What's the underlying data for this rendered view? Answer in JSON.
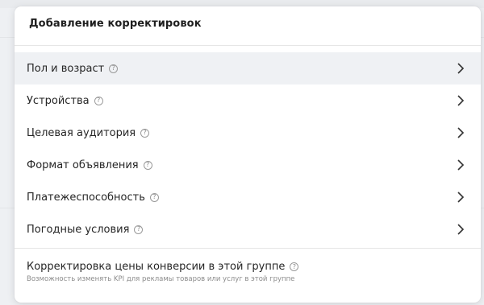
{
  "popup": {
    "title": "Добавление корректировок",
    "items": [
      {
        "label": "Пол и возраст",
        "help": "?"
      },
      {
        "label": "Устройства",
        "help": "?"
      },
      {
        "label": "Целевая аудитория",
        "help": "?"
      },
      {
        "label": "Формат объявления",
        "help": "?"
      },
      {
        "label": "Платежеспособность",
        "help": "?"
      },
      {
        "label": "Погодные условия",
        "help": "?"
      }
    ],
    "footer": {
      "title": "Корректировка цены конверсии в этой группе",
      "help": "?",
      "subtitle": "Возможность изменять KPI для рекламы товаров или услуг в этой группе"
    }
  },
  "colors": {
    "active_row_bg": "#eff1f4",
    "text": "#262626",
    "muted": "#8c8c8c"
  },
  "icons": {
    "help": "question-circle-icon",
    "chevron": "chevron-right-icon"
  }
}
